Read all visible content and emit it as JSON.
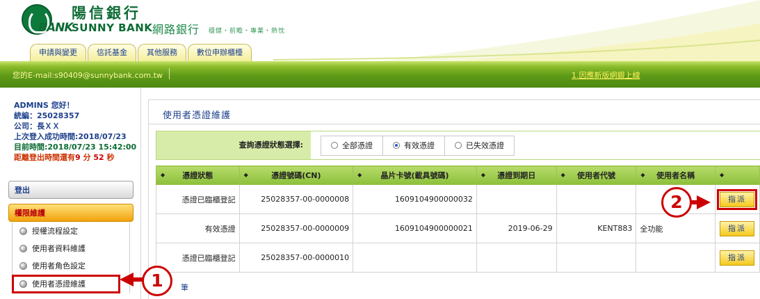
{
  "header": {
    "brand_cn": "陽信銀行",
    "brand_en": "SUNNY BANK",
    "logo_bank": "BANK",
    "online": "網路銀行",
    "slogan": "穩健・前瞻・專業・熱忱",
    "tabs": [
      {
        "label": "申請與變更"
      },
      {
        "label": "信託基金"
      },
      {
        "label": "其他服務"
      },
      {
        "label": "數位申辦櫃檯"
      }
    ]
  },
  "topbar": {
    "email": "您的E-mail:s90409@sunnybank.com.tw",
    "notice_link": "1.因應新版網銀上線"
  },
  "sidebar": {
    "greeting": "ADMINS 您好！",
    "tax_id": "統編：25028357",
    "company": "公司：長ＸＸ",
    "last_login": "上次登入成功時間:2018/07/23",
    "current_time": "目前時間:2018/07/23 15:42:00",
    "logout_prefix": "距離登出時間還有",
    "logout_min": "9",
    "logout_min_unit": "分",
    "logout_sec": "52",
    "logout_sec_unit": "秒",
    "logout_label": "登出",
    "perm_label": "權限維護",
    "submenu": [
      {
        "label": "授權流程設定"
      },
      {
        "label": "使用者資料維護"
      },
      {
        "label": "使用者角色設定"
      },
      {
        "label": "使用者憑證維護"
      }
    ]
  },
  "main": {
    "title": "使用者憑證維護",
    "query_label": "查詢憑證狀態選擇:",
    "radio_options": [
      {
        "label": "全部憑證",
        "checked": false
      },
      {
        "label": "有效憑證",
        "checked": true
      },
      {
        "label": "已失效憑證",
        "checked": false
      }
    ],
    "columns": [
      "憑證狀態",
      "憑證號碼(CN)",
      "晶片卡號(載具號碼)",
      "憑證到期日",
      "使用者代號",
      "使用者名稱",
      ""
    ],
    "rows": [
      {
        "status": "憑證已臨櫃登記",
        "cert_no": "25028357-00-0000008",
        "chip_no": "1609104900000032",
        "expiry": "",
        "user_id": "",
        "user_name": "",
        "action": "指派"
      },
      {
        "status": "有效憑證",
        "cert_no": "25028357-00-0000009",
        "chip_no": "1609104900000021",
        "expiry": "2019-06-29",
        "user_id": "KENT883",
        "user_name": "全功能",
        "action": "指派"
      },
      {
        "status": "憑證已臨櫃登記",
        "cert_no": "25028357-00-0000010",
        "chip_no": "",
        "expiry": "",
        "user_id": "",
        "user_name": "",
        "action": "指派"
      }
    ],
    "footer_note": "筆"
  },
  "callouts": {
    "one": "1",
    "two": "2"
  },
  "colors": {
    "brand_green": "#0d6b35",
    "bar_green": "#5d9a17",
    "link_blue": "#1c3f8c",
    "highlight_red": "#cc0000",
    "button_gold": "#f4c81c"
  }
}
